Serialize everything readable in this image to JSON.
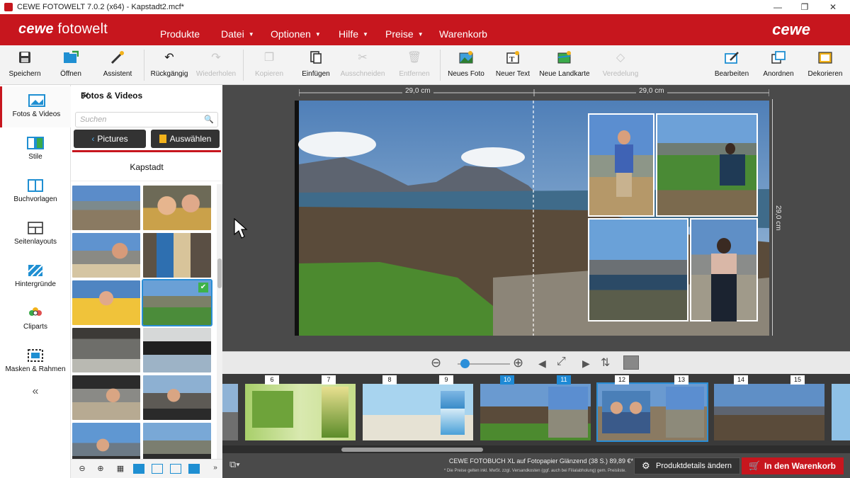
{
  "window": {
    "title": "CEWE FOTOWELT 7.0.2 (x64) - Kapstadt2.mcf*",
    "minimize": "—",
    "maximize": "❐",
    "close": "✕"
  },
  "menubar": {
    "brand_prefix": "cewe",
    "brand_suffix": "fotowelt",
    "brand_right": "cewe",
    "items": [
      {
        "label": "Produkte",
        "dropdown": false
      },
      {
        "label": "Datei",
        "dropdown": true
      },
      {
        "label": "Optionen",
        "dropdown": true
      },
      {
        "label": "Hilfe",
        "dropdown": true
      },
      {
        "label": "Preise",
        "dropdown": true
      },
      {
        "label": "Warenkorb",
        "dropdown": false
      }
    ]
  },
  "toolbar": {
    "save": "Speichern",
    "open": "Öffnen",
    "assistant": "Assistent",
    "undo": "Rückgängig",
    "redo": "Wiederholen",
    "copy": "Kopieren",
    "paste": "Einfügen",
    "cut": "Ausschneiden",
    "remove": "Entfernen",
    "new_photo": "Neues Foto",
    "new_text": "Neuer Text",
    "new_map": "Neue Landkarte",
    "refine": "Veredelung",
    "edit": "Bearbeiten",
    "arrange": "Anordnen",
    "decorate": "Dekorieren"
  },
  "leftnav": {
    "items": [
      {
        "label": "Fotos & Videos",
        "active": true
      },
      {
        "label": "Stile",
        "active": false
      },
      {
        "label": "Buchvorlagen",
        "active": false
      },
      {
        "label": "Seitenlayouts",
        "active": false
      },
      {
        "label": "Hintergründe",
        "active": false
      },
      {
        "label": "Cliparts",
        "active": false
      },
      {
        "label": "Masken & Rahmen",
        "active": false
      }
    ],
    "collapse": "«"
  },
  "panel": {
    "title": "Fotos & Videos",
    "close": "✕",
    "search_placeholder": "Suchen",
    "back_button": "Pictures",
    "select_button": "Auswählen",
    "folder": "Kapstadt",
    "scroll_more": "»"
  },
  "canvas": {
    "ruler_left": "29,0 cm",
    "ruler_right": "29,0 cm",
    "ruler_vertical": "29,0 cm"
  },
  "strip": {
    "spreads": [
      {
        "left": "",
        "right": ""
      },
      {
        "left": "6",
        "right": "7"
      },
      {
        "left": "8",
        "right": "9"
      },
      {
        "left": "10",
        "right": "11",
        "current": true
      },
      {
        "left": "12",
        "right": "13",
        "selected": true
      },
      {
        "left": "14",
        "right": "15"
      }
    ]
  },
  "status": {
    "product": "CEWE FOTOBUCH XL auf Fotopapier Glänzend (38 S.) 89,89 €*",
    "note": "* Die Preise gelten inkl. MwSt. zzgl. Versandkosten (ggf. auch bei Filialabholung) gem. Preisliste.",
    "details_button": "Produktdetails ändern",
    "cart_button": "In den Warenkorb"
  },
  "colors": {
    "brand_red": "#c7161e",
    "selection_blue": "#2a8ed6",
    "canvas_bg": "#4a4a4a"
  },
  "icons": {
    "save": "floppy-icon",
    "open": "folder-open-icon",
    "assistant": "magic-wand-icon",
    "undo": "undo-icon",
    "zoom_out": "zoom-out-icon",
    "zoom_in": "zoom-in-icon",
    "cart": "cart-icon",
    "gear": "gear-icon"
  }
}
